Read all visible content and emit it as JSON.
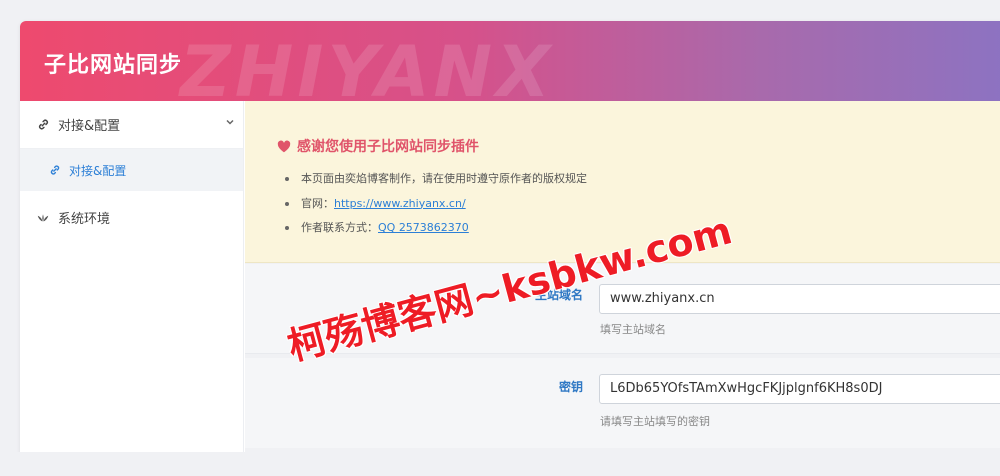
{
  "header": {
    "title": "子比网站同步",
    "watermark": "ZHIYANX"
  },
  "sidebar": {
    "items": [
      {
        "label": "对接&配置",
        "icon": "link-icon",
        "expanded": true
      },
      {
        "label": "对接&配置",
        "icon": "link-icon",
        "active": true
      },
      {
        "label": "系统环境",
        "icon": "leaf-icon"
      }
    ]
  },
  "notice": {
    "title": "感谢您使用子比网站同步插件",
    "lines": {
      "line1": "本页面由奕焰博客制作，请在使用时遵守原作者的版权规定",
      "line2_label": "官网：",
      "line2_link": "https://www.zhiyanx.cn/",
      "line3_label": "作者联系方式：",
      "line3_link": "QQ 2573862370"
    }
  },
  "form": {
    "domain": {
      "label": "主站域名",
      "value": "www.zhiyanx.cn",
      "hint": "填写主站域名"
    },
    "secret": {
      "label": "密钥",
      "value": "L6Db65YOfsTAmXwHgcFKJjplgnf6KH8s0DJ",
      "hint": "请填写主站填写的密钥"
    }
  },
  "overlay_watermark": "柯殇博客网~ksbkw.com",
  "colors": {
    "header_start": "#ee4a6e",
    "header_end": "#8c73c2",
    "accent_blue": "#2c7fd6",
    "notice_bg": "#fbf5dc",
    "notice_title": "#e0546a"
  }
}
